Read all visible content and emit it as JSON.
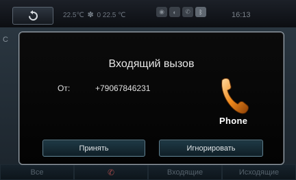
{
  "status_bar": {
    "temp_left": "22.5",
    "temp_unit": "℃",
    "fan_level": "0",
    "temp_right": "22.5",
    "status_icons": [
      "media-icon",
      "steering-icon",
      "call-icon",
      "bluetooth-icon"
    ],
    "clock": "16:13"
  },
  "background": {
    "partial_text": "C"
  },
  "bottom_tabs": [
    {
      "label": "Все"
    },
    {
      "label": ""
    },
    {
      "label": "Входящие"
    },
    {
      "label": "Исходящие"
    }
  ],
  "dialog": {
    "title": "Входящий вызов",
    "from_label": "От:",
    "from_number": "+79067846231",
    "icon_label": "Phone",
    "accept_label": "Принять",
    "ignore_label": "Игнорировать"
  },
  "colors": {
    "accent_orange": "#f08a1c",
    "dialog_border": "#9aa3ab",
    "button_border": "#5c7e8e"
  }
}
